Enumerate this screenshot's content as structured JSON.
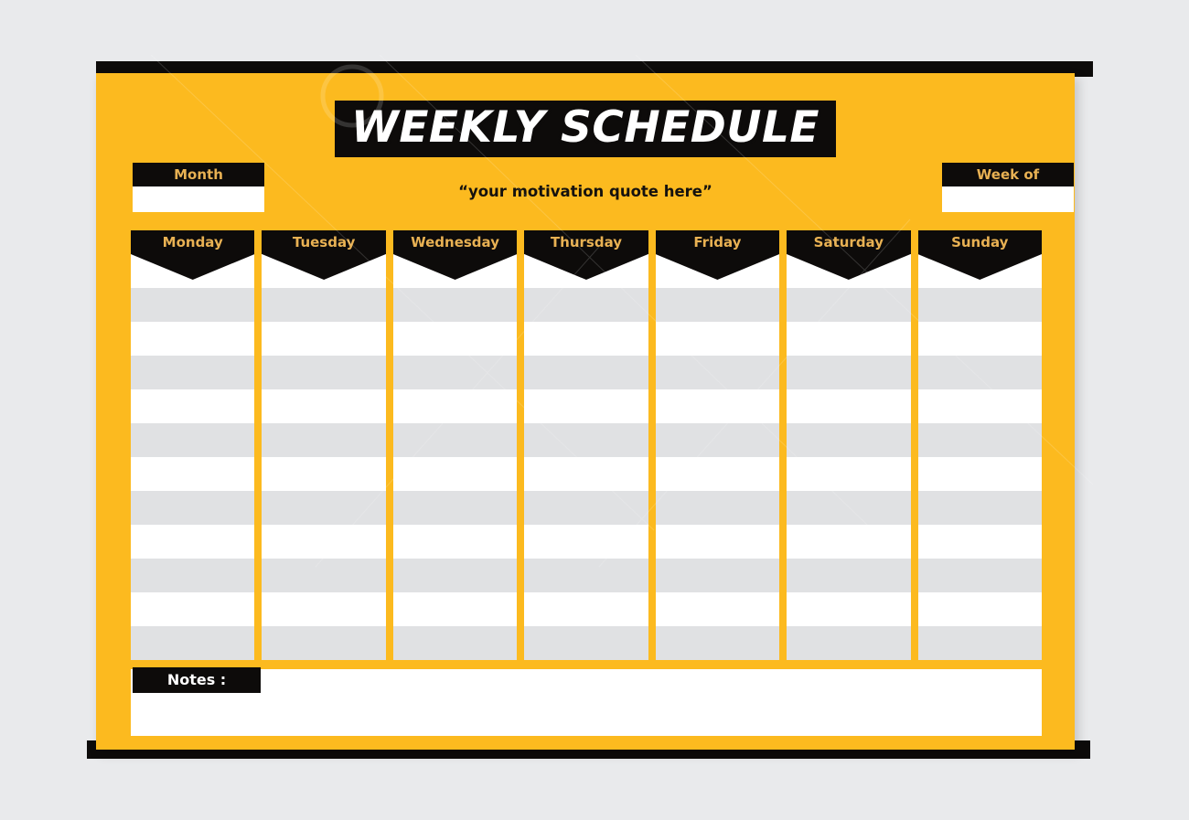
{
  "document": {
    "title": "WEEKLY SCHEDULE",
    "quote": "“your motivation quote here”"
  },
  "fields": {
    "month": {
      "label": "Month",
      "value": "",
      "placeholder": ""
    },
    "week_of": {
      "label": "Week of",
      "value": "",
      "placeholder": ""
    }
  },
  "schedule": {
    "days": [
      {
        "label": "Monday"
      },
      {
        "label": "Tuesday"
      },
      {
        "label": "Wednesday"
      },
      {
        "label": "Thursday"
      },
      {
        "label": "Friday"
      },
      {
        "label": "Saturday"
      },
      {
        "label": "Sunday"
      }
    ],
    "row_count": 12,
    "rows": [
      "",
      "",
      "",
      "",
      "",
      "",
      "",
      "",
      "",
      "",
      "",
      ""
    ]
  },
  "notes": {
    "label": "Notes :",
    "value": "",
    "placeholder": ""
  },
  "colors": {
    "background": "#e9eaec",
    "sheet": "#fcba1f",
    "ink": "#0d0b0a",
    "accent_gold": "#e8b153",
    "row_white": "#ffffff",
    "row_gray": "#e0e1e3"
  }
}
